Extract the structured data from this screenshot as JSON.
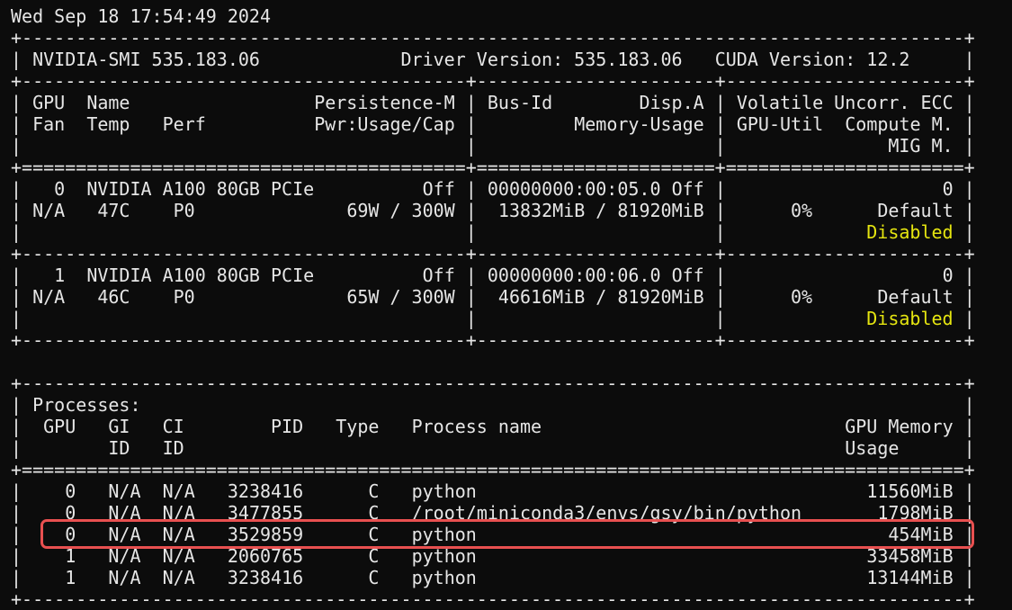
{
  "terminal": {
    "timestamp": "Wed Sep 18 17:54:49 2024",
    "smi_version_text": "NVIDIA-SMI 535.183.06",
    "driver_version_text": "Driver Version: 535.183.06",
    "cuda_version_text": "CUDA Version: 12.2",
    "gpu_table_headers": {
      "gpu": "GPU",
      "name": "Name",
      "persistence": "Persistence-M",
      "bus_id": "Bus-Id",
      "disp": "Disp.A",
      "volatile_ecc": "Volatile Uncorr. ECC",
      "fan": "Fan",
      "temp": "Temp",
      "perf": "Perf",
      "pwr": "Pwr:Usage/Cap",
      "memory_usage": "Memory-Usage",
      "gpu_util": "GPU-Util",
      "compute_mode": "Compute M.",
      "mig": "MIG M."
    },
    "gpus": [
      {
        "index": "0",
        "name": "NVIDIA A100 80GB PCIe",
        "persistence": "Off",
        "bus_id": "00000000:00:05.0",
        "disp": "Off",
        "ecc": "0",
        "fan": "N/A",
        "temp": "47C",
        "perf": "P0",
        "power": "69W / 300W",
        "memory": "13832MiB / 81920MiB",
        "util": "0%",
        "compute_mode": "Default",
        "mig": "Disabled"
      },
      {
        "index": "1",
        "name": "NVIDIA A100 80GB PCIe",
        "persistence": "Off",
        "bus_id": "00000000:00:06.0",
        "disp": "Off",
        "ecc": "0",
        "fan": "N/A",
        "temp": "46C",
        "perf": "P0",
        "power": "65W / 300W",
        "memory": "46616MiB / 81920MiB",
        "util": "0%",
        "compute_mode": "Default",
        "mig": "Disabled"
      }
    ],
    "processes_title": "Processes:",
    "process_headers": {
      "gpu": "GPU",
      "gi": "GI",
      "gi_sub": "ID",
      "ci": "CI",
      "ci_sub": "ID",
      "pid": "PID",
      "type": "Type",
      "name": "Process name",
      "mem": "GPU Memory",
      "mem_sub": "Usage"
    },
    "processes": [
      {
        "gpu": "0",
        "gi": "N/A",
        "ci": "N/A",
        "pid": "3238416",
        "type": "C",
        "name": "python",
        "mem": "11560MiB"
      },
      {
        "gpu": "0",
        "gi": "N/A",
        "ci": "N/A",
        "pid": "3477855",
        "type": "C",
        "name": "/root/miniconda3/envs/gsy/bin/python",
        "mem": "1798MiB"
      },
      {
        "gpu": "0",
        "gi": "N/A",
        "ci": "N/A",
        "pid": "3529859",
        "type": "C",
        "name": "python",
        "mem": "454MiB"
      },
      {
        "gpu": "1",
        "gi": "N/A",
        "ci": "N/A",
        "pid": "2060765",
        "type": "C",
        "name": "python",
        "mem": "33458MiB"
      },
      {
        "gpu": "1",
        "gi": "N/A",
        "ci": "N/A",
        "pid": "3238416",
        "type": "C",
        "name": "python",
        "mem": "13144MiB"
      }
    ],
    "highlighted_process_row": 2,
    "colors": {
      "background": "#0c0c0c",
      "text": "#e6e6e6",
      "mig_disabled": "#e5e510",
      "highlight": "#e85050"
    }
  }
}
